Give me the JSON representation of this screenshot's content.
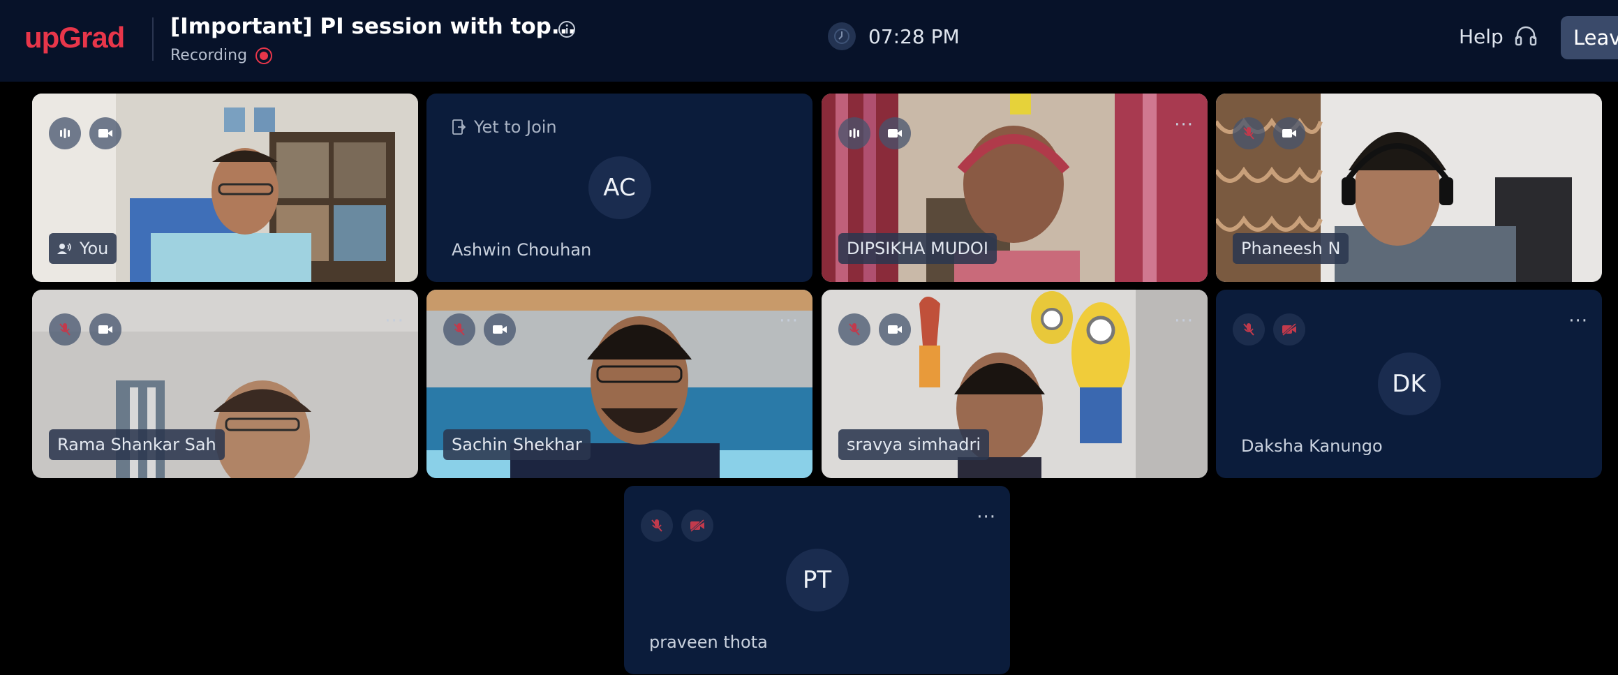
{
  "header": {
    "logo": "upGrad",
    "title": "[Important] PI session with top...",
    "recording_label": "Recording",
    "time": "07:28 PM",
    "help_label": "Help",
    "leave_label": "Leave"
  },
  "colors": {
    "brand": "#e8364a",
    "header_bg": "#071229",
    "tile_bg": "#0b1c3b",
    "muted_red": "#c23a4c"
  },
  "participants": [
    {
      "name": "You",
      "video": true,
      "mic": "active",
      "camera": "on"
    },
    {
      "name": "Ashwin Chouhan",
      "initials": "AC",
      "status": "Yet to Join",
      "video": false
    },
    {
      "name": "DIPSIKHA MUDOI",
      "video": true,
      "mic": "active",
      "camera": "on"
    },
    {
      "name": "Phaneesh N",
      "video": true,
      "mic": "muted",
      "camera": "on"
    },
    {
      "name": "Rama Shankar Sah",
      "video": true,
      "mic": "muted",
      "camera": "on"
    },
    {
      "name": "Sachin Shekhar",
      "video": true,
      "mic": "muted",
      "camera": "on"
    },
    {
      "name": "sravya simhadri",
      "video": true,
      "mic": "muted",
      "camera": "on"
    },
    {
      "name": "Daksha Kanungo",
      "initials": "DK",
      "video": false,
      "mic": "muted",
      "camera": "off"
    },
    {
      "name": "praveen thota",
      "initials": "PT",
      "video": false,
      "mic": "muted",
      "camera": "off"
    }
  ],
  "more_glyph": "···"
}
